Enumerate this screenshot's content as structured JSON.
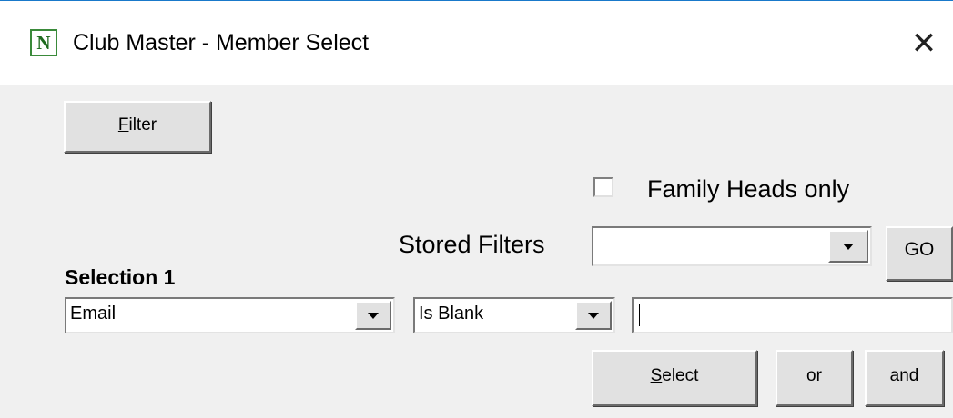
{
  "window": {
    "icon_letter": "N",
    "title": "Club Master - Member Select",
    "close_glyph": "✕"
  },
  "toolbar": {
    "filter_label_first": "F",
    "filter_label_rest": "ilter"
  },
  "options": {
    "family_heads_only_label": "Family Heads only",
    "family_heads_only_checked": false
  },
  "stored_filters": {
    "label": "Stored Filters",
    "selected": "",
    "go_label": "GO"
  },
  "selection": {
    "heading": "Selection 1",
    "field_value": "Email",
    "operator_value": "Is Blank",
    "criteria_value": ""
  },
  "actions": {
    "select_label_first": "S",
    "select_label_rest": "elect",
    "or_label": "or",
    "and_label": "and"
  }
}
